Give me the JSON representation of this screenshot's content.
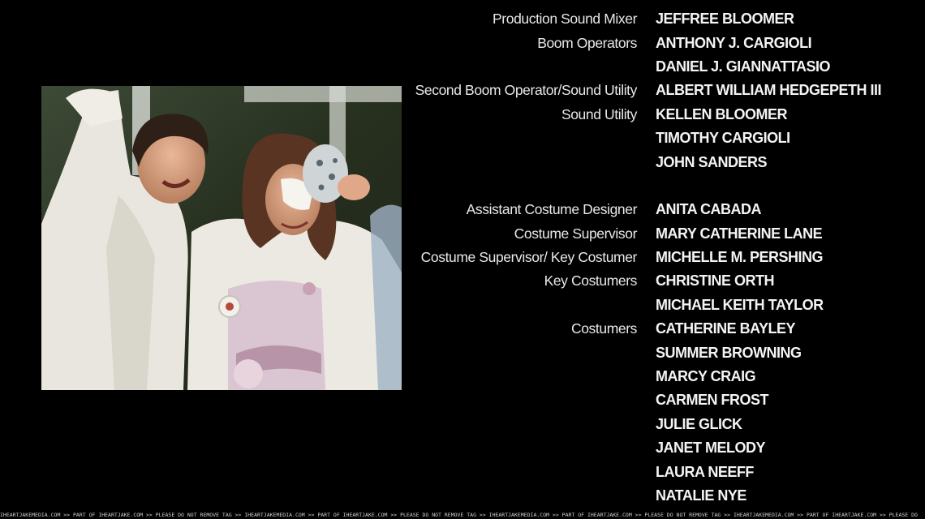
{
  "credits": [
    {
      "role": "Production Sound Mixer",
      "name": "JEFFREE BLOOMER"
    },
    {
      "role": "Boom Operators",
      "name": "ANTHONY J. CARGIOLI"
    },
    {
      "role": "",
      "name": "DANIEL J. GIANNATTASIO"
    },
    {
      "role": "Second Boom Operator/Sound Utility",
      "name": "ALBERT WILLIAM HEDGEPETH III"
    },
    {
      "role": "Sound Utility",
      "name": "KELLEN BLOOMER"
    },
    {
      "role": "",
      "name": "TIMOTHY CARGIOLI"
    },
    {
      "role": "",
      "name": "JOHN SANDERS"
    },
    {
      "role": "",
      "name": ""
    },
    {
      "role": "Assistant Costume Designer",
      "name": "ANITA CABADA"
    },
    {
      "role": "Costume Supervisor",
      "name": "MARY CATHERINE LANE"
    },
    {
      "role": "Costume Supervisor/ Key Costumer",
      "name": "MICHELLE M. PERSHING"
    },
    {
      "role": "Key Costumers",
      "name": "CHRISTINE ORTH"
    },
    {
      "role": "",
      "name": "MICHAEL KEITH TAYLOR"
    },
    {
      "role": "Costumers",
      "name": "CATHERINE BAYLEY"
    },
    {
      "role": "",
      "name": "SUMMER BROWNING"
    },
    {
      "role": "",
      "name": "MARCY CRAIG"
    },
    {
      "role": "",
      "name": "CARMEN FROST"
    },
    {
      "role": "",
      "name": "JULIE GLICK"
    },
    {
      "role": "",
      "name": "JANET MELODY"
    },
    {
      "role": "",
      "name": "LAURA NEEFF"
    },
    {
      "role": "",
      "name": "NATALIE NYE"
    }
  ],
  "watermark": "IHEARTJAKEMEDIA.COM >> PART OF IHEARTJAKE.COM >> PLEASE DO NOT REMOVE TAG >> IHEARTJAKEMEDIA.COM >> PART OF IHEARTJAKE.COM >> PLEASE DO NOT REMOVE TAG >> IHEARTJAKEMEDIA.COM >> PART OF IHEARTJAKE.COM >> PLEASE DO NOT REMOVE TAG >> IHEARTJAKEMEDIA.COM >> PART OF IHEARTJAKE.COM >> PLEASE DO"
}
